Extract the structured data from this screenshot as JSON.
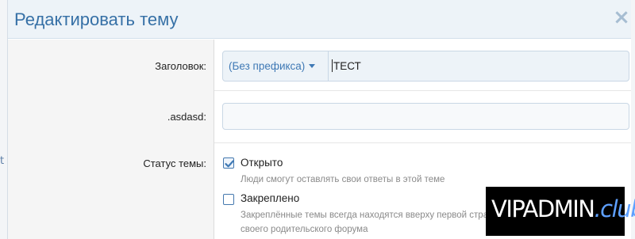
{
  "dialog": {
    "title": "Редактировать тему",
    "close_label": "×"
  },
  "form": {
    "title_field": {
      "label": "Заголовок:",
      "prefix": "(Без префикса)",
      "value": "ТЕСТ"
    },
    "custom_field": {
      "label": ".asdasd:",
      "value": ""
    },
    "status": {
      "label": "Статус темы:",
      "options": [
        {
          "label": "Открыто",
          "checked": true,
          "hint": "Люди смогут оставлять свои ответы в этой теме"
        },
        {
          "label": "Закреплено",
          "checked": false,
          "hint_line1": "Закреплённые темы всегда находятся вверху первой страницы",
          "hint_line2": "своего родительского форума"
        }
      ]
    }
  },
  "background": {
    "left_fragment": "t"
  },
  "watermark": {
    "main": "VIPADMIN",
    "suffix": ".club"
  },
  "colors": {
    "accent": "#3670a6",
    "link": "#3f79b5",
    "checkbox": "#4478ae"
  }
}
